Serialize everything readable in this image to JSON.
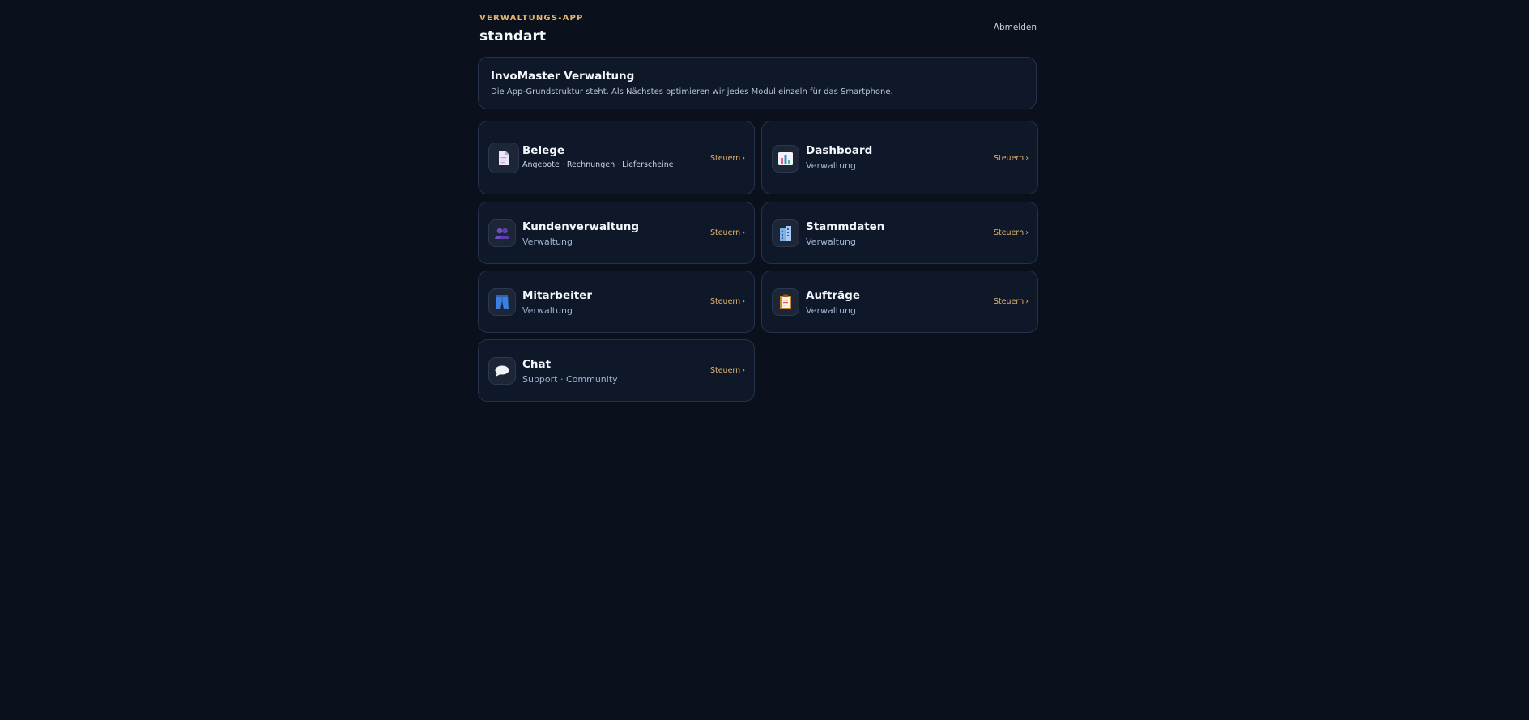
{
  "header": {
    "eyebrow": "VERWALTUNGS-APP",
    "title": "standart",
    "logout_label": "Abmelden"
  },
  "intro": {
    "title": "InvoMaster Verwaltung",
    "description": "Die App-Grundstruktur steht. Als Nächstes optimieren wir jedes Modul einzeln für das Smartphone."
  },
  "modules": [
    {
      "title": "Belege",
      "subtitle": "Angebote · Rechnungen · Lieferscheine",
      "action": "Steuern",
      "icon": "document-icon"
    },
    {
      "title": "Dashboard",
      "subtitle": "Verwaltung",
      "action": "Steuern",
      "icon": "bar-chart-icon"
    },
    {
      "title": "Kundenverwaltung",
      "subtitle": "Verwaltung",
      "action": "Steuern",
      "icon": "users-icon"
    },
    {
      "title": "Stammdaten",
      "subtitle": "Verwaltung",
      "action": "Steuern",
      "icon": "building-icon"
    },
    {
      "title": "Mitarbeiter",
      "subtitle": "Verwaltung",
      "action": "Steuern",
      "icon": "jeans-icon"
    },
    {
      "title": "Aufträge",
      "subtitle": "Verwaltung",
      "action": "Steuern",
      "icon": "clipboard-icon"
    },
    {
      "title": "Chat",
      "subtitle": "Support · Community",
      "action": "Steuern",
      "icon": "speech-bubble-icon"
    }
  ],
  "chevron": "›",
  "colors": {
    "background": "#0a111c",
    "card": "#0e1828",
    "border": "#25324a",
    "accent": "#e6b46e",
    "muted": "#9fb2cf"
  }
}
